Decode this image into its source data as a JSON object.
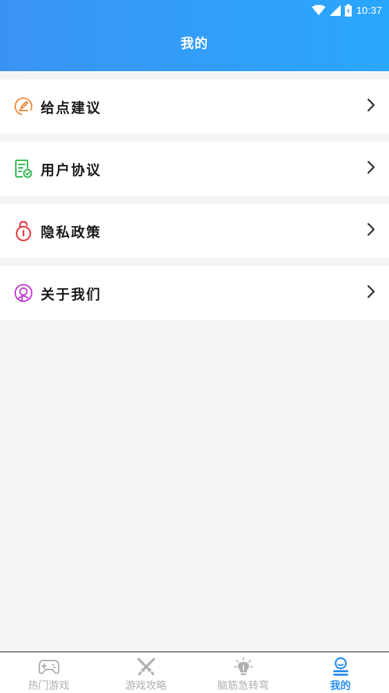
{
  "status_bar": {
    "time": "10:37",
    "icons": [
      "wifi-icon",
      "signal-icon",
      "battery-icon"
    ]
  },
  "header": {
    "title": "我的"
  },
  "menu": {
    "items": [
      {
        "label": "给点建议",
        "icon": "feedback-icon",
        "color": "#f08a3c"
      },
      {
        "label": "用户协议",
        "icon": "agreement-icon",
        "color": "#2db84a"
      },
      {
        "label": "隐私政策",
        "icon": "lock-icon",
        "color": "#e8383d"
      },
      {
        "label": "关于我们",
        "icon": "about-icon",
        "color": "#c13ccf"
      }
    ]
  },
  "tabbar": {
    "tabs": [
      {
        "label": "热门游戏",
        "icon": "gamepad-icon",
        "active": false
      },
      {
        "label": "游戏攻略",
        "icon": "crossed-swords-icon",
        "active": false
      },
      {
        "label": "脑筋急转弯",
        "icon": "lightbulb-icon",
        "active": false
      },
      {
        "label": "我的",
        "icon": "profile-icon",
        "active": true
      }
    ],
    "active_color": "#2a8ff0",
    "inactive_color": "#b0b0b0"
  }
}
